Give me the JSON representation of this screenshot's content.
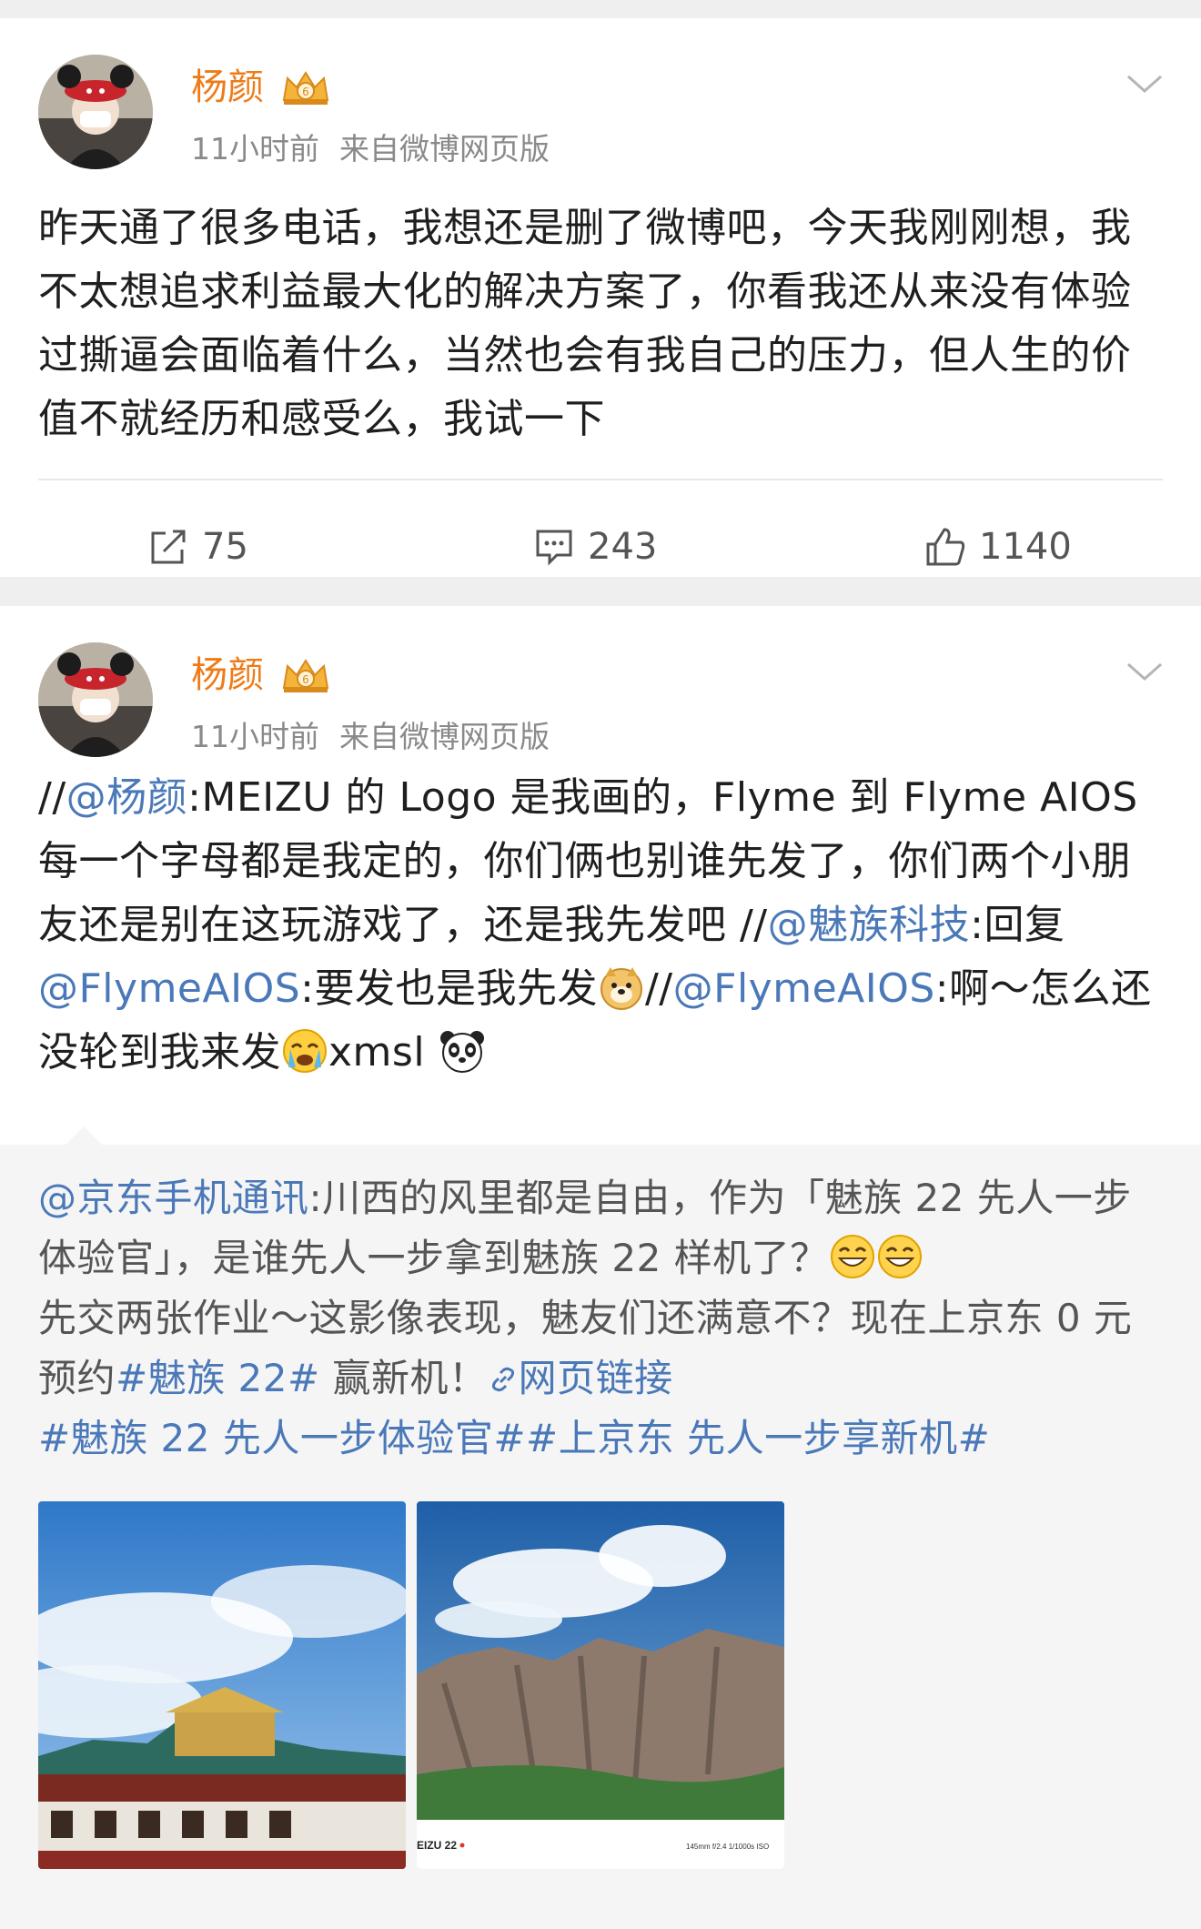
{
  "posts": [
    {
      "author": "杨颜",
      "time": "11小时前",
      "source": "来自微博网页版",
      "text": "昨天通了很多电话，我想还是删了微博吧，今天我刚刚想，我不太想追求利益最大化的解决方案了，你看我还从来没有体验过撕逼会面临着什么，当然也会有我自己的压力，但人生的价值不就经历和感受么，我试一下",
      "actions": {
        "share": "75",
        "comment": "243",
        "like": "1140"
      }
    },
    {
      "author": "杨颜",
      "time": "11小时前",
      "source": "来自微博网页版",
      "text_parts": {
        "p1": "//",
        "mention1": "@杨颜",
        "p2": ":MEIZU 的 Logo 是我画的，Flyme 到 Flyme AIOS 每一个字母都是我定的，你们俩也别谁先发了，你们两个小朋友还是别在这玩游戏了，还是我先发吧 //",
        "mention2": "@魅族科技",
        "p3": ":回复 ",
        "mention3": "@FlymeAIOS",
        "p4": ":要发也是我先发",
        "p5": "//",
        "mention4": "@FlymeAIOS",
        "p6": ":啊～怎么还没轮到我来发",
        "p7": "xmsl"
      },
      "emoji": [
        "doge-emoji",
        "crying-emoji",
        "panda-emoji"
      ],
      "repost": {
        "mention": "@京东手机通讯",
        "t1": ":川西的风里都是自由，作为「魅族 22 先人一步体验官」，是谁先人一步拿到魅族 22 样机了？",
        "t2": "先交两张作业～这影像表现，魅友们还满意不？现在上京东 0 元预约",
        "hashtag1": "#魅族 22#",
        "t3": " 赢新机！",
        "weblink": "网页链接",
        "hashtag2": "#魅族 22 先人一步体验官##上京东 先人一步享新机#",
        "photo2_caption_left": "EIZU 22",
        "photo2_caption_right": "145mm f/2.4 1/1000s ISO"
      }
    }
  ],
  "colors": {
    "username": "#ee7b18",
    "link": "#4a78b8",
    "meta": "#8a8a8a"
  }
}
